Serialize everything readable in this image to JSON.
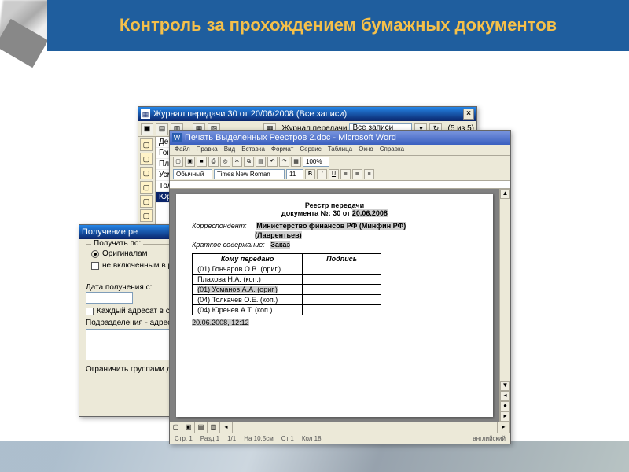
{
  "slide": {
    "title": "Контроль за прохождением бумажных документов"
  },
  "journal": {
    "title": "Журнал передачи 30 от 20/06/2008 (Все записи)",
    "toolbar_label": "Журнал передачи",
    "filter_value": "Все записи",
    "counter": "(5 из 5)",
    "rows": [
      "Держат",
      "Гончаров",
      "Плаховa",
      "Усманов",
      "Толкачев",
      "Юренев"
    ]
  },
  "receive": {
    "title": "Получение ре",
    "group_label": "Получать по:",
    "opt_originals": "Оригиналам",
    "opt_not_included": "не включенным в ре",
    "date_label": "Дата получения с:",
    "chk_each": "Каждый адресат в свс",
    "div_label": "Подразделения - адресаты",
    "limit_label": "Ограничить группами до"
  },
  "word": {
    "title": "Печать Выделенных Реестров 2.doc - Microsoft Word",
    "menu": [
      "Файл",
      "Правка",
      "Вид",
      "Вставка",
      "Формат",
      "Сервис",
      "Таблица",
      "Окно",
      "Справка"
    ],
    "style": "Обычный",
    "font": "Times New Roman",
    "size": "11",
    "zoom": "100%",
    "doc": {
      "h1": "Реестр передачи",
      "h2_a": "документа №: ",
      "h2_b": "30 от ",
      "h2_c": "20.06.2008",
      "corr_label": "Корреспондент:",
      "corr_value_a": "Министерство финансов РФ (Минфин РФ)",
      "corr_value_b": "(Лаврентьев)",
      "brief_label": "Краткое содержание:",
      "brief_value": "Заказ",
      "col1": "Кому передано",
      "col2": "Подпись",
      "rows": [
        "(01) Гончаров О.В. (ориг.)",
        "Плахова Н.А. (коп.)",
        "(01) Усманов А.А. (ориг.)",
        "(04) Толкачев О.Е. (коп.)",
        "(04) Юренев А.Т. (коп.)"
      ],
      "footer_ts": "20.06.2008, 12:12"
    },
    "status": [
      "Стр. 1",
      "Разд 1",
      "1/1",
      "На 10,5см",
      "Ст 1",
      "Кол 18",
      "английский"
    ]
  }
}
